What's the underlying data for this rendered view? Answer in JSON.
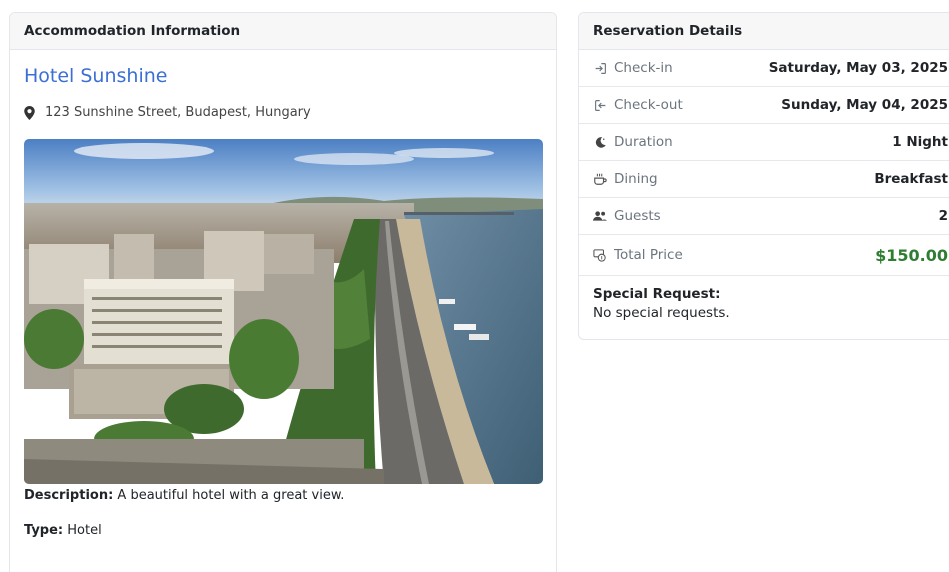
{
  "accommodation": {
    "header": "Accommodation Information",
    "hotel_name": "Hotel Sunshine",
    "address": "123 Sunshine Street, Budapest, Hungary",
    "description_label": "Description:",
    "description": "A beautiful hotel with a great view.",
    "type_label": "Type:",
    "type": "Hotel"
  },
  "reservation": {
    "header": "Reservation Details",
    "rows": [
      {
        "label": "Check-in",
        "value": "Saturday, May 03, 2025",
        "icon": "check-in-icon"
      },
      {
        "label": "Check-out",
        "value": "Sunday, May 04, 2025",
        "icon": "check-out-icon"
      },
      {
        "label": "Duration",
        "value": "1 Night",
        "icon": "moon-icon"
      },
      {
        "label": "Dining",
        "value": "Breakfast",
        "icon": "mug-icon"
      },
      {
        "label": "Guests",
        "value": "2",
        "icon": "users-icon"
      },
      {
        "label": "Total Price",
        "value": "$150.00",
        "icon": "money-icon"
      }
    ],
    "special_request_label": "Special Request:",
    "special_request": "No special requests."
  },
  "colors": {
    "link_blue": "#3b6fd4",
    "price_green": "#2e7d32"
  }
}
